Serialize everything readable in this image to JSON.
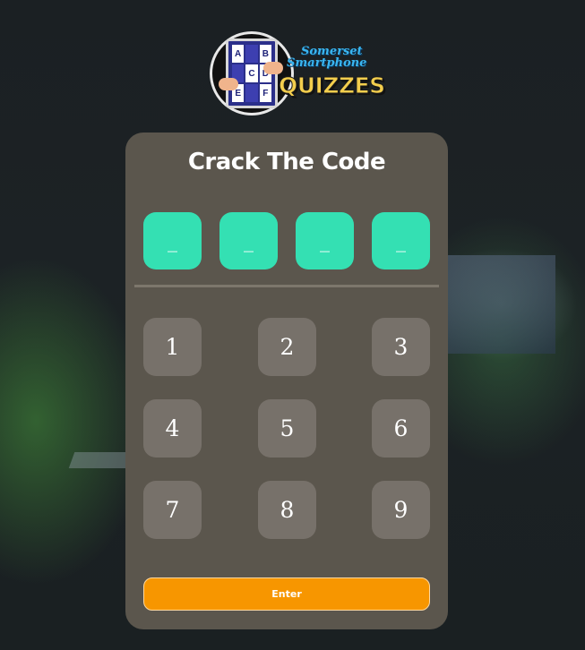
{
  "logo": {
    "brand_line1": "Somerset",
    "brand_line2": "Smartphone",
    "brand_main": "QUIZZES",
    "tablet_letters": [
      "A",
      "B",
      "",
      "",
      "C",
      "D",
      "E",
      "",
      "F"
    ]
  },
  "card": {
    "title": "Crack The Code",
    "code_slots": [
      "_",
      "_",
      "_",
      "_"
    ],
    "keys": [
      "1",
      "2",
      "3",
      "4",
      "5",
      "6",
      "7",
      "8",
      "9"
    ],
    "enter_label": "Enter"
  },
  "colors": {
    "card_bg": "#5b564d",
    "code_slot": "#34e0b3",
    "key_bg": "#77716a",
    "enter_button": "#f79600",
    "page_bg": "#1a1f22"
  }
}
